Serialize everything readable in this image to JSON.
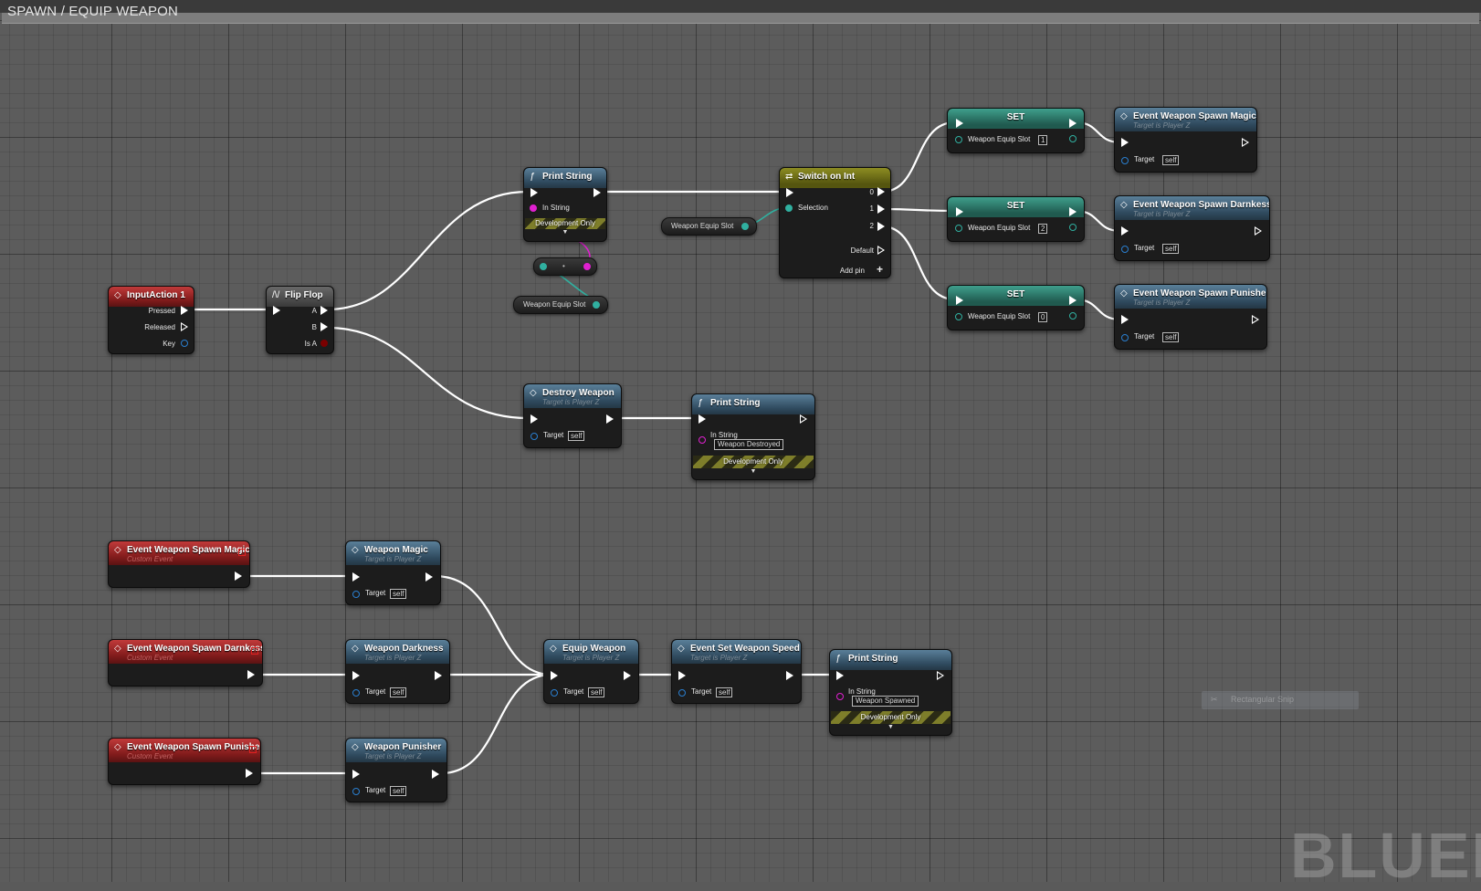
{
  "graph": {
    "comment_title": "SPAWN / EQUIP WEAPON",
    "watermark": "BLUEPR"
  },
  "snap_tooltip": {
    "label": "Rectangular Snip"
  },
  "nodes": {
    "input_action": {
      "title": "InputAction 1",
      "pressed": "Pressed",
      "released": "Released",
      "key": "Key"
    },
    "flip_flop": {
      "title": "Flip Flop",
      "a": "A",
      "b": "B",
      "is_a": "Is A"
    },
    "print_string_top": {
      "title": "Print String",
      "in_string": "In String",
      "dev": "Development Only"
    },
    "weapon_equip_slot_var1": "Weapon Equip Slot",
    "weapon_equip_slot_var2": "Weapon Equip Slot",
    "switch_on_int": {
      "title": "Switch on Int",
      "selection": "Selection",
      "out0": "0",
      "out1": "1",
      "out2": "2",
      "default": "Default",
      "add_pin": "Add pin"
    },
    "set1": {
      "title": "SET",
      "label": "Weapon Equip Slot",
      "value": "1"
    },
    "set2": {
      "title": "SET",
      "label": "Weapon Equip Slot",
      "value": "2"
    },
    "set0": {
      "title": "SET",
      "label": "Weapon Equip Slot",
      "value": "0"
    },
    "evt_call_magic": {
      "title": "Event Weapon Spawn Magic",
      "subtitle": "Target is Player Z",
      "target": "Target",
      "self": "self"
    },
    "evt_call_darkness": {
      "title": "Event Weapon Spawn Darnkess",
      "subtitle": "Target is Player Z",
      "target": "Target",
      "self": "self"
    },
    "evt_call_punisher": {
      "title": "Event Weapon Spawn Punisher",
      "subtitle": "Target is Player Z",
      "target": "Target",
      "self": "self"
    },
    "destroy_weapon": {
      "title": "Destroy Weapon",
      "subtitle": "Target is Player Z",
      "target": "Target",
      "self": "self"
    },
    "print_string_destroy": {
      "title": "Print String",
      "in_string": "In String",
      "value": "Weapon Destroyed",
      "dev": "Development Only"
    },
    "custom_magic": {
      "title": "Event Weapon Spawn Magic",
      "subtitle": "Custom Event"
    },
    "custom_darkness": {
      "title": "Event Weapon Spawn Darnkess",
      "subtitle": "Custom Event"
    },
    "custom_punisher": {
      "title": "Event Weapon Spawn Punisher",
      "subtitle": "Custom Event"
    },
    "weapon_magic": {
      "title": "Weapon Magic",
      "subtitle": "Target is Player Z",
      "target": "Target",
      "self": "self"
    },
    "weapon_darkness": {
      "title": "Weapon Darkness",
      "subtitle": "Target is Player Z",
      "target": "Target",
      "self": "self"
    },
    "weapon_punisher": {
      "title": "Weapon Punisher",
      "subtitle": "Target is Player Z",
      "target": "Target",
      "self": "self"
    },
    "equip_weapon": {
      "title": "Equip Weapon",
      "subtitle": "Target is Player Z",
      "target": "Target",
      "self": "self"
    },
    "set_weapon_speed": {
      "title": "Event Set Weapon Speed",
      "subtitle": "Target is Player Z",
      "target": "Target",
      "self": "self"
    },
    "print_string_spawn": {
      "title": "Print String",
      "in_string": "In String",
      "value": "Weapon Spawned",
      "dev": "Development Only"
    }
  },
  "colors": {
    "exec_wire": "#ffffff",
    "int_wire": "#30b0a0",
    "string_wire": "#e020d0"
  }
}
